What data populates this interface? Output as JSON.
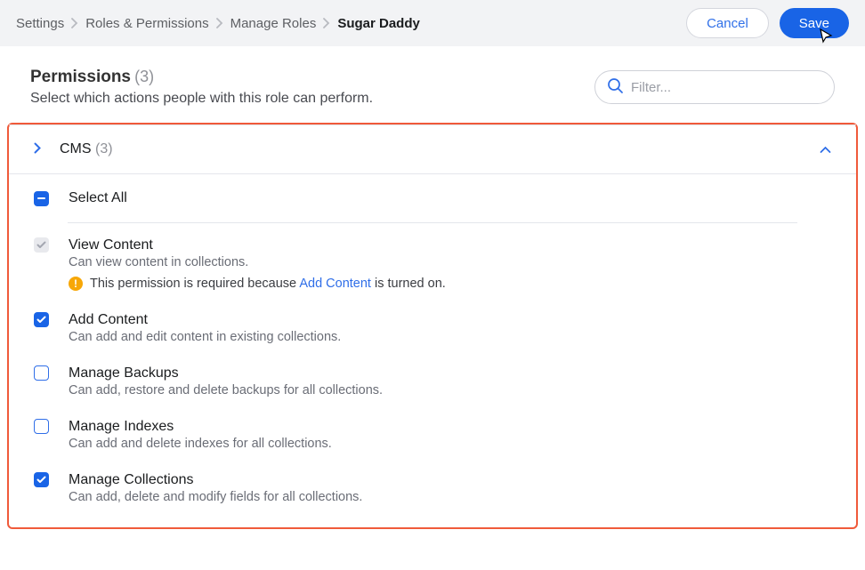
{
  "breadcrumbs": {
    "items": [
      "Settings",
      "Roles & Permissions",
      "Manage Roles",
      "Sugar Daddy"
    ]
  },
  "actions": {
    "cancel": "Cancel",
    "save": "Save"
  },
  "page": {
    "title": "Permissions",
    "count": "(3)",
    "subtitle": "Select which actions people with this role can perform."
  },
  "filter": {
    "placeholder": "Filter..."
  },
  "section": {
    "title": "CMS",
    "count": "(3)"
  },
  "selectAll": {
    "label": "Select All"
  },
  "permissions": [
    {
      "state": "locked",
      "title": "View Content",
      "desc": "Can view content in collections.",
      "note_prefix": "This permission is required because ",
      "note_link": "Add Content",
      "note_suffix": " is turned on."
    },
    {
      "state": "checked",
      "title": "Add Content",
      "desc": "Can add and edit content in existing collections."
    },
    {
      "state": "empty",
      "title": "Manage Backups",
      "desc": "Can add, restore and delete backups for all collections."
    },
    {
      "state": "empty",
      "title": "Manage Indexes",
      "desc": "Can add and delete indexes for all collections."
    },
    {
      "state": "checked",
      "title": "Manage Collections",
      "desc": "Can add, delete and modify fields for all collections."
    }
  ]
}
